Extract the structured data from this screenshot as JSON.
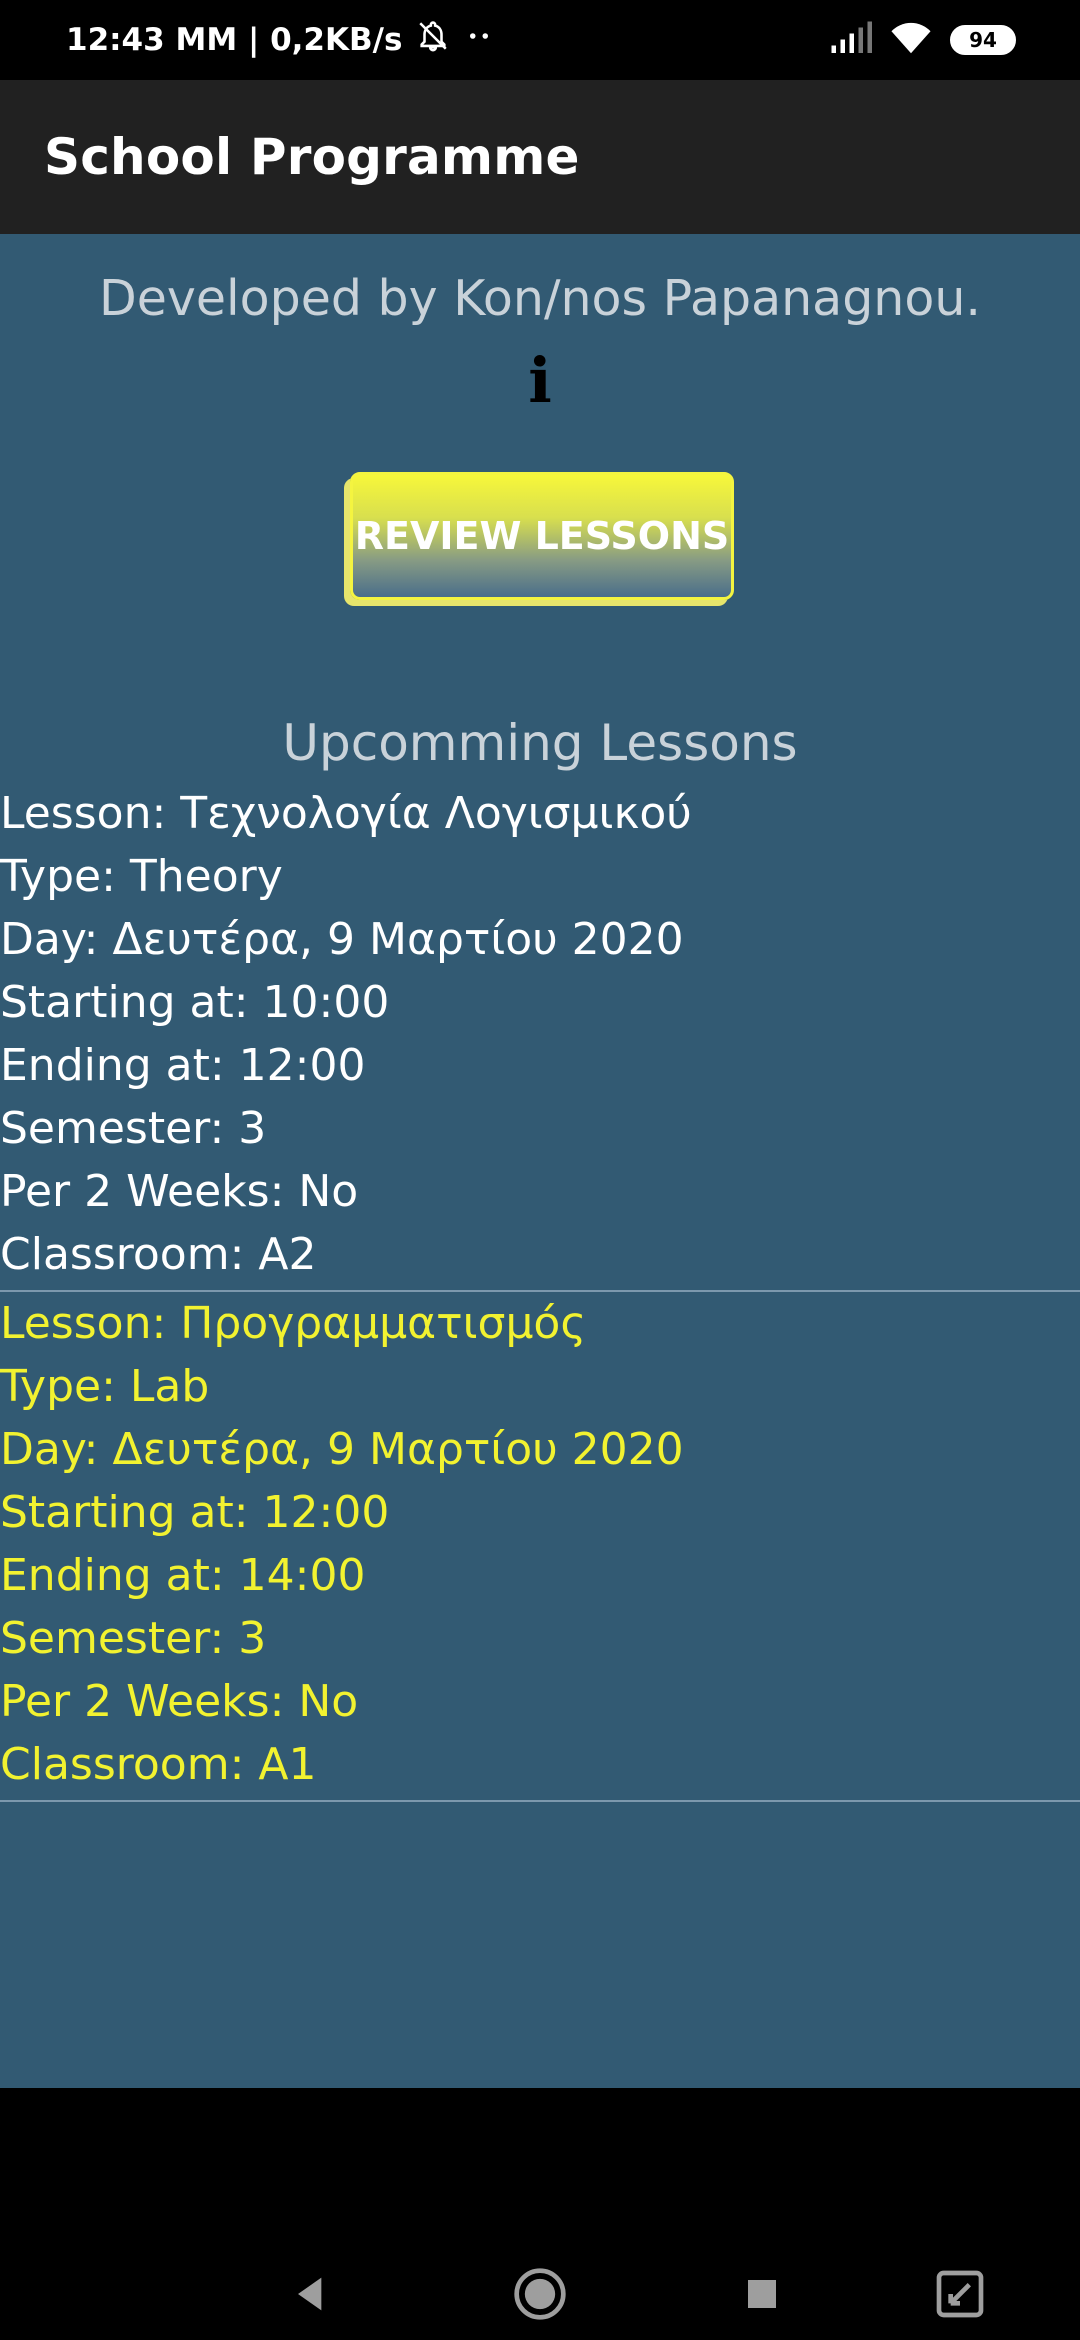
{
  "status_bar": {
    "time_info": "12:43 ΜΜ | 0,2KB/s",
    "battery": "94"
  },
  "app_bar": {
    "title": "School Programme"
  },
  "developer_text": "Developed by Kon/nos Papanagnou.",
  "info_icon_glyph": "i",
  "review_button_label": "REVIEW LESSONS",
  "section_title": "Upcomming Lessons",
  "lessons": [
    {
      "lesson": "Lesson: Τεχνολογία Λογισμικού",
      "type": "Type: Theory",
      "day": "Day: Δευτέρα, 9 Μαρτίου 2020",
      "start": "Starting at: 10:00",
      "end": "Ending at: 12:00",
      "semester": "Semester: 3",
      "per2weeks": "Per 2 Weeks: No",
      "classroom": "Classroom: A2"
    },
    {
      "lesson": "Lesson: Προγραμματισμός",
      "type": "Type: Lab",
      "day": "Day: Δευτέρα, 9 Μαρτίου 2020",
      "start": "Starting at: 12:00",
      "end": "Ending at: 14:00",
      "semester": "Semester: 3",
      "per2weeks": "Per 2 Weeks: No",
      "classroom": "Classroom: A1"
    }
  ],
  "colors": {
    "content_bg": "#325a73",
    "app_bar_bg": "#212121",
    "highlight_text": "#f2f230"
  },
  "icons": {
    "status": [
      "notifications-off-icon",
      "more-dots-icon",
      "signal-icon",
      "wifi-icon",
      "battery-icon"
    ],
    "nav": [
      "back-icon",
      "home-icon",
      "recents-icon",
      "screen-expand-icon"
    ]
  }
}
